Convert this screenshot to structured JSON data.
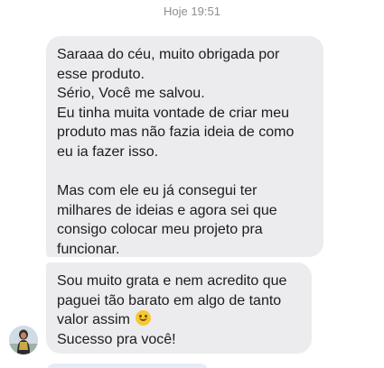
{
  "chat": {
    "timestamp": "Hoje 19:51",
    "messages": [
      {
        "paragraphs": [
          [
            "Saraaa do céu, muito obrigada por",
            "esse produto.",
            "Sério, Você me salvou.",
            "Eu tinha muita vontade de criar meu",
            "produto mas não fazia ideia de como",
            "eu ia fazer isso."
          ],
          [
            "Mas com ele eu já consegui ter",
            "milhares de ideias e agora sei que",
            "consigo colocar meu projeto pra",
            "funcionar."
          ]
        ]
      },
      {
        "lines": [
          "Sou muito grata e nem acredito que",
          "paguei tão barato em algo de tanto",
          "valor assim",
          "Sucesso pra você!"
        ],
        "emoji": "smiling-face-emoji"
      }
    ],
    "sender_avatar": "avatar-photo"
  }
}
